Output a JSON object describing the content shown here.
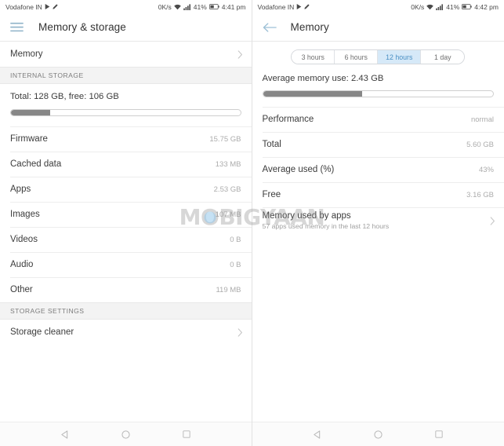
{
  "left": {
    "statusbar": {
      "carrier": "Vodafone IN",
      "net_speed": "0K/s",
      "battery_pct": "41%",
      "time": "4:41 pm",
      "icons": [
        "play-icon",
        "pencil-icon",
        "wifi-icon",
        "signal-icon",
        "battery-icon"
      ]
    },
    "appbar": {
      "icon": "hamburger-menu-icon",
      "title": "Memory & storage"
    },
    "memory_row": {
      "label": "Memory",
      "chevron": "chevron-right-icon"
    },
    "internal_header": "INTERNAL STORAGE",
    "summary": {
      "text": "Total: 128 GB, free: 106 GB",
      "fill_percent": 17
    },
    "items": [
      {
        "label": "Firmware",
        "value": "15.75 GB"
      },
      {
        "label": "Cached data",
        "value": "133 MB"
      },
      {
        "label": "Apps",
        "value": "2.53 GB"
      },
      {
        "label": "Images",
        "value": "107 MB"
      },
      {
        "label": "Videos",
        "value": "0 B"
      },
      {
        "label": "Audio",
        "value": "0 B"
      },
      {
        "label": "Other",
        "value": "119 MB"
      }
    ],
    "settings_header": "STORAGE SETTINGS",
    "storage_cleaner": {
      "label": "Storage cleaner",
      "chevron": "chevron-right-icon"
    }
  },
  "right": {
    "statusbar": {
      "carrier": "Vodafone IN",
      "net_speed": "0K/s",
      "battery_pct": "41%",
      "time": "4:42 pm",
      "icons": [
        "play-icon",
        "pencil-icon",
        "wifi-icon",
        "signal-icon",
        "battery-icon"
      ]
    },
    "appbar": {
      "icon": "back-arrow-icon",
      "title": "Memory"
    },
    "tabs": [
      {
        "label": "3 hours",
        "active": false
      },
      {
        "label": "6 hours",
        "active": false
      },
      {
        "label": "12 hours",
        "active": true
      },
      {
        "label": "1 day",
        "active": false
      }
    ],
    "summary": {
      "text": "Average memory use: 2.43 GB",
      "fill_percent": 43
    },
    "items": [
      {
        "label": "Performance",
        "value": "normal"
      },
      {
        "label": "Total",
        "value": "5.60 GB"
      },
      {
        "label": "Average used (%)",
        "value": "43%"
      },
      {
        "label": "Free",
        "value": "3.16 GB"
      }
    ],
    "memory_used_by_apps": {
      "title": "Memory used by apps",
      "subtitle": "57 apps used memory in the last 12 hours",
      "chevron": "chevron-right-icon"
    }
  },
  "navbar": {
    "back": "back-triangle-icon",
    "home": "home-circle-icon",
    "recents": "recents-square-icon"
  },
  "watermark": {
    "part1": "M",
    "part2": "O",
    "part3": "BIGYAAN"
  },
  "colors": {
    "accent": "#4a90c4",
    "accent_bg": "#d6e9f8",
    "bar_fill": "#878787",
    "section_bg": "#f3f3f3",
    "icon_blue": "#8fb3c9"
  }
}
